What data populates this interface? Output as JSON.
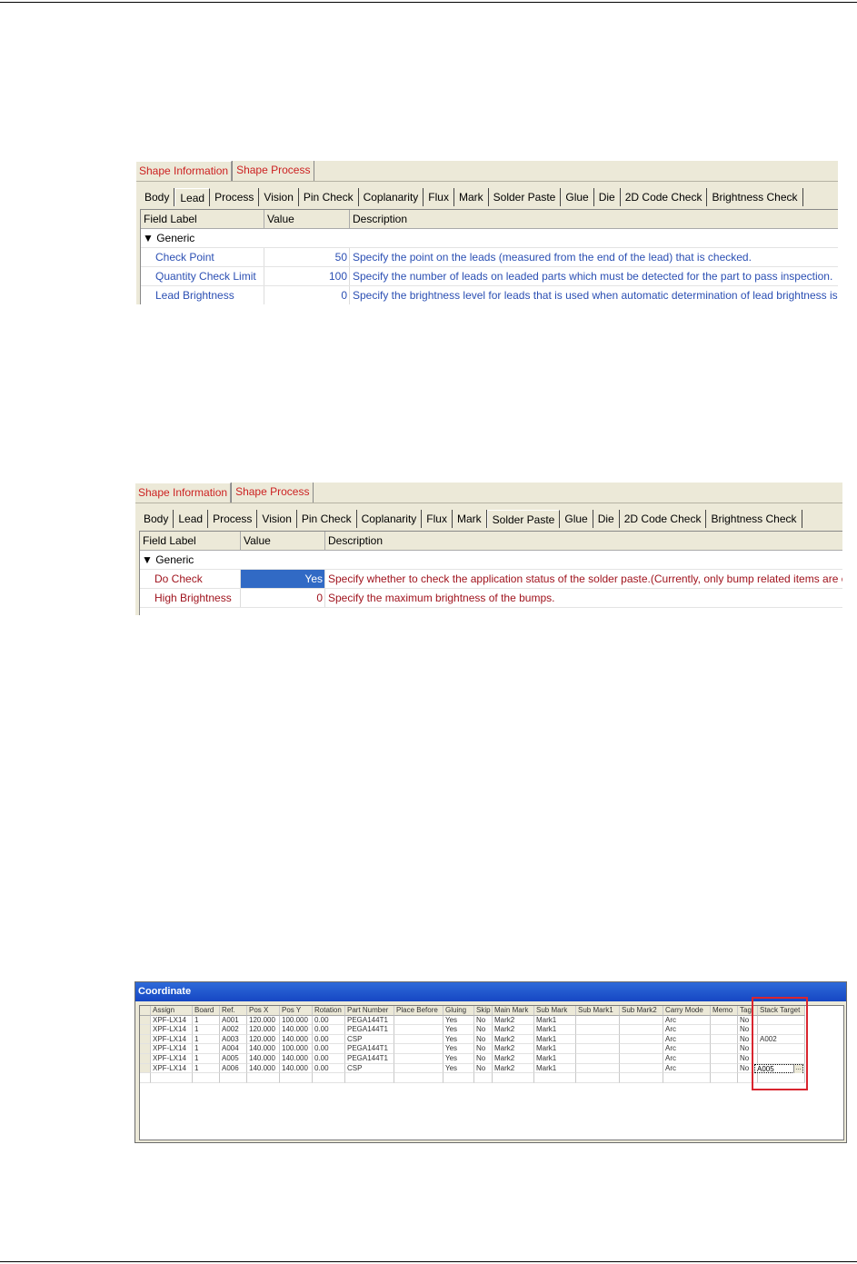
{
  "panel1": {
    "top_tabs": [
      "Shape Information",
      "Shape Process"
    ],
    "sub_tabs": [
      "Body",
      "Lead",
      "Process",
      "Vision",
      "Pin Check",
      "Coplanarity",
      "Flux",
      "Mark",
      "Solder Paste",
      "Glue",
      "Die",
      "2D Code Check",
      "Brightness Check"
    ],
    "active_sub_tab": "Lead",
    "columns": [
      "Field Label",
      "Value",
      "Description"
    ],
    "group": "▼ Generic",
    "rows": [
      {
        "label": "Check Point",
        "value": "50",
        "desc": "Specify the point on the leads (measured from the end of the lead) that is checked."
      },
      {
        "label": "Quantity Check Limit",
        "value": "100",
        "desc": "Specify the number of leads on leaded parts which must be detected for the part to pass inspection."
      },
      {
        "label": "Lead Brightness",
        "value": "0",
        "desc": "Specify the brightness level for leads that is used when automatic determination of lead brightness is difficult."
      }
    ]
  },
  "panel2": {
    "top_tabs": [
      "Shape Information",
      "Shape Process"
    ],
    "sub_tabs": [
      "Body",
      "Lead",
      "Process",
      "Vision",
      "Pin Check",
      "Coplanarity",
      "Flux",
      "Mark",
      "Solder Paste",
      "Glue",
      "Die",
      "2D Code Check",
      "Brightness Check"
    ],
    "active_sub_tab": "Solder Paste",
    "columns": [
      "Field Label",
      "Value",
      "Description"
    ],
    "group": "▼ Generic",
    "rows": [
      {
        "label": "Do Check",
        "value": "Yes",
        "desc": "Specify whether to check the application status of the solder paste.(Currently, only bump related items are checked.)"
      },
      {
        "label": "High Brightness",
        "value": "0",
        "desc": "Specify the maximum brightness of the bumps."
      }
    ]
  },
  "coordinate": {
    "title": "Coordinate",
    "columns": [
      "Assign",
      "Board",
      "Ref.",
      "Pos X",
      "Pos Y",
      "Rotation",
      "Part Number",
      "Place Before",
      "Gluing",
      "Skip",
      "Main Mark",
      "Sub Mark",
      "Sub Mark1",
      "Sub Mark2",
      "Carry Mode",
      "Memo",
      "Tag",
      "Stack Target"
    ],
    "rows": [
      [
        "XPF-LX14",
        "1",
        "A001",
        "120.000",
        "100.000",
        "0.00",
        "PEGA144T1",
        "",
        "Yes",
        "No",
        "Mark2",
        "Mark1",
        "",
        "",
        "Arc",
        "",
        "No",
        ""
      ],
      [
        "XPF-LX14",
        "1",
        "A002",
        "120.000",
        "140.000",
        "0.00",
        "PEGA144T1",
        "",
        "Yes",
        "No",
        "Mark2",
        "Mark1",
        "",
        "",
        "Arc",
        "",
        "No",
        ""
      ],
      [
        "XPF-LX14",
        "1",
        "A003",
        "120.000",
        "140.000",
        "0.00",
        "CSP",
        "",
        "Yes",
        "No",
        "Mark2",
        "Mark1",
        "",
        "",
        "Arc",
        "",
        "No",
        "A002"
      ],
      [
        "XPF-LX14",
        "1",
        "A004",
        "140.000",
        "100.000",
        "0.00",
        "PEGA144T1",
        "",
        "Yes",
        "No",
        "Mark2",
        "Mark1",
        "",
        "",
        "Arc",
        "",
        "No",
        ""
      ],
      [
        "XPF-LX14",
        "1",
        "A005",
        "140.000",
        "140.000",
        "0.00",
        "PEGA144T1",
        "",
        "Yes",
        "No",
        "Mark2",
        "Mark1",
        "",
        "",
        "Arc",
        "",
        "No",
        ""
      ],
      [
        "XPF-LX14",
        "1",
        "A006",
        "140.000",
        "140.000",
        "0.00",
        "CSP",
        "",
        "Yes",
        "No",
        "Mark2",
        "Mark1",
        "",
        "",
        "Arc",
        "",
        "No",
        ""
      ]
    ],
    "stack_dropdown_value": "A005",
    "stack_dropdown_arrow": "…"
  },
  "colors": {
    "highlight": "#d9252f",
    "selection": "#316ac5",
    "panel_bg": "#ece9d8"
  }
}
